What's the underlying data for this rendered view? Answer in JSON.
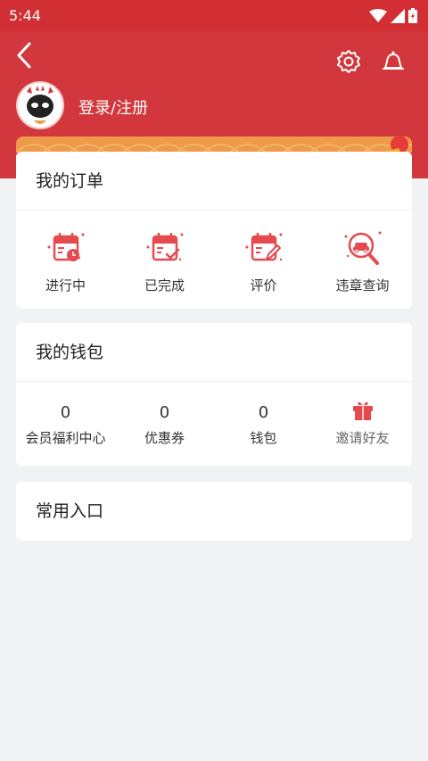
{
  "statusbar": {
    "time": "5:44"
  },
  "header": {
    "login_label": "登录/注册"
  },
  "orders": {
    "title": "我的订单",
    "items": [
      {
        "label": "进行中",
        "icon": "calendar-clock-icon"
      },
      {
        "label": "已完成",
        "icon": "calendar-check-icon"
      },
      {
        "label": "评价",
        "icon": "calendar-edit-icon"
      },
      {
        "label": "违章查询",
        "icon": "car-search-icon"
      }
    ]
  },
  "wallet": {
    "title": "我的钱包",
    "items": [
      {
        "value": "0",
        "label": "会员福利中心"
      },
      {
        "value": "0",
        "label": "优惠券"
      },
      {
        "value": "0",
        "label": "钱包"
      },
      {
        "label": "邀请好友",
        "icon": "gift-icon"
      }
    ]
  },
  "common": {
    "title": "常用入口"
  },
  "colors": {
    "brand": "#d1373c",
    "accent": "#e54a4f",
    "background": "#f2f3f5"
  }
}
